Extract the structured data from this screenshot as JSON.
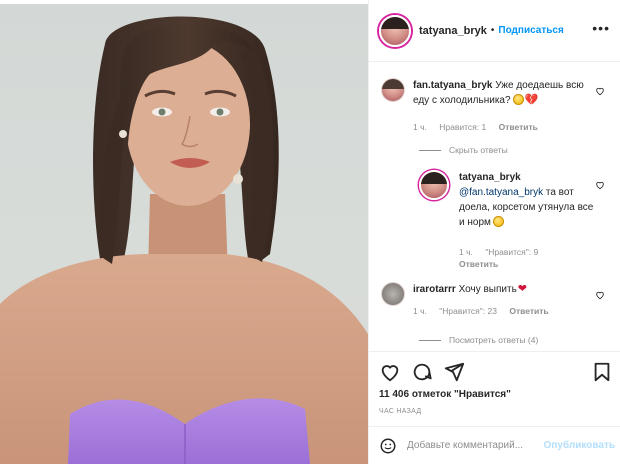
{
  "header": {
    "username": "tatyana_bryk",
    "separator": "•",
    "follow_label": "Подписаться",
    "more_icon": "more-horizontal-icon"
  },
  "comments": [
    {
      "username": "fan.tatyana_bryk",
      "text": "Уже доедаешь всю еду с холодильника?",
      "emoji": [
        "grinning-sweat-emoji",
        "broken-heart-emoji"
      ],
      "time": "1 ч.",
      "likes": "Нравится: 1",
      "reply": "Ответить"
    },
    {
      "toggle": "Скрыть ответы"
    },
    {
      "username": "tatyana_bryk",
      "mention": "@fan.tatyana_bryk",
      "text": "та вот доела, корсетом утянула все и норм",
      "emoji": [
        "grinning-sweat-emoji"
      ],
      "time": "1 ч.",
      "likes": "\"Нравится\": 9",
      "reply": "Ответить"
    },
    {
      "username": "irarotarrr",
      "text": "Хочу выпить",
      "emoji": [
        "red-heart-emoji"
      ],
      "time": "1 ч.",
      "likes": "\"Нравится\": 23",
      "reply": "Ответить"
    },
    {
      "toggle": "Посмотреть ответы (4)"
    }
  ],
  "actions": {
    "icons": [
      "heart-icon",
      "comment-icon",
      "share-icon",
      "bookmark-icon"
    ]
  },
  "likes_text": "11 406 отметок \"Нравится\"",
  "time_ago": "ЧАС НАЗАД",
  "add_comment": {
    "placeholder": "Добавьте комментарий...",
    "publish_label": "Опубликовать",
    "emoji_icon": "smiley-icon"
  }
}
